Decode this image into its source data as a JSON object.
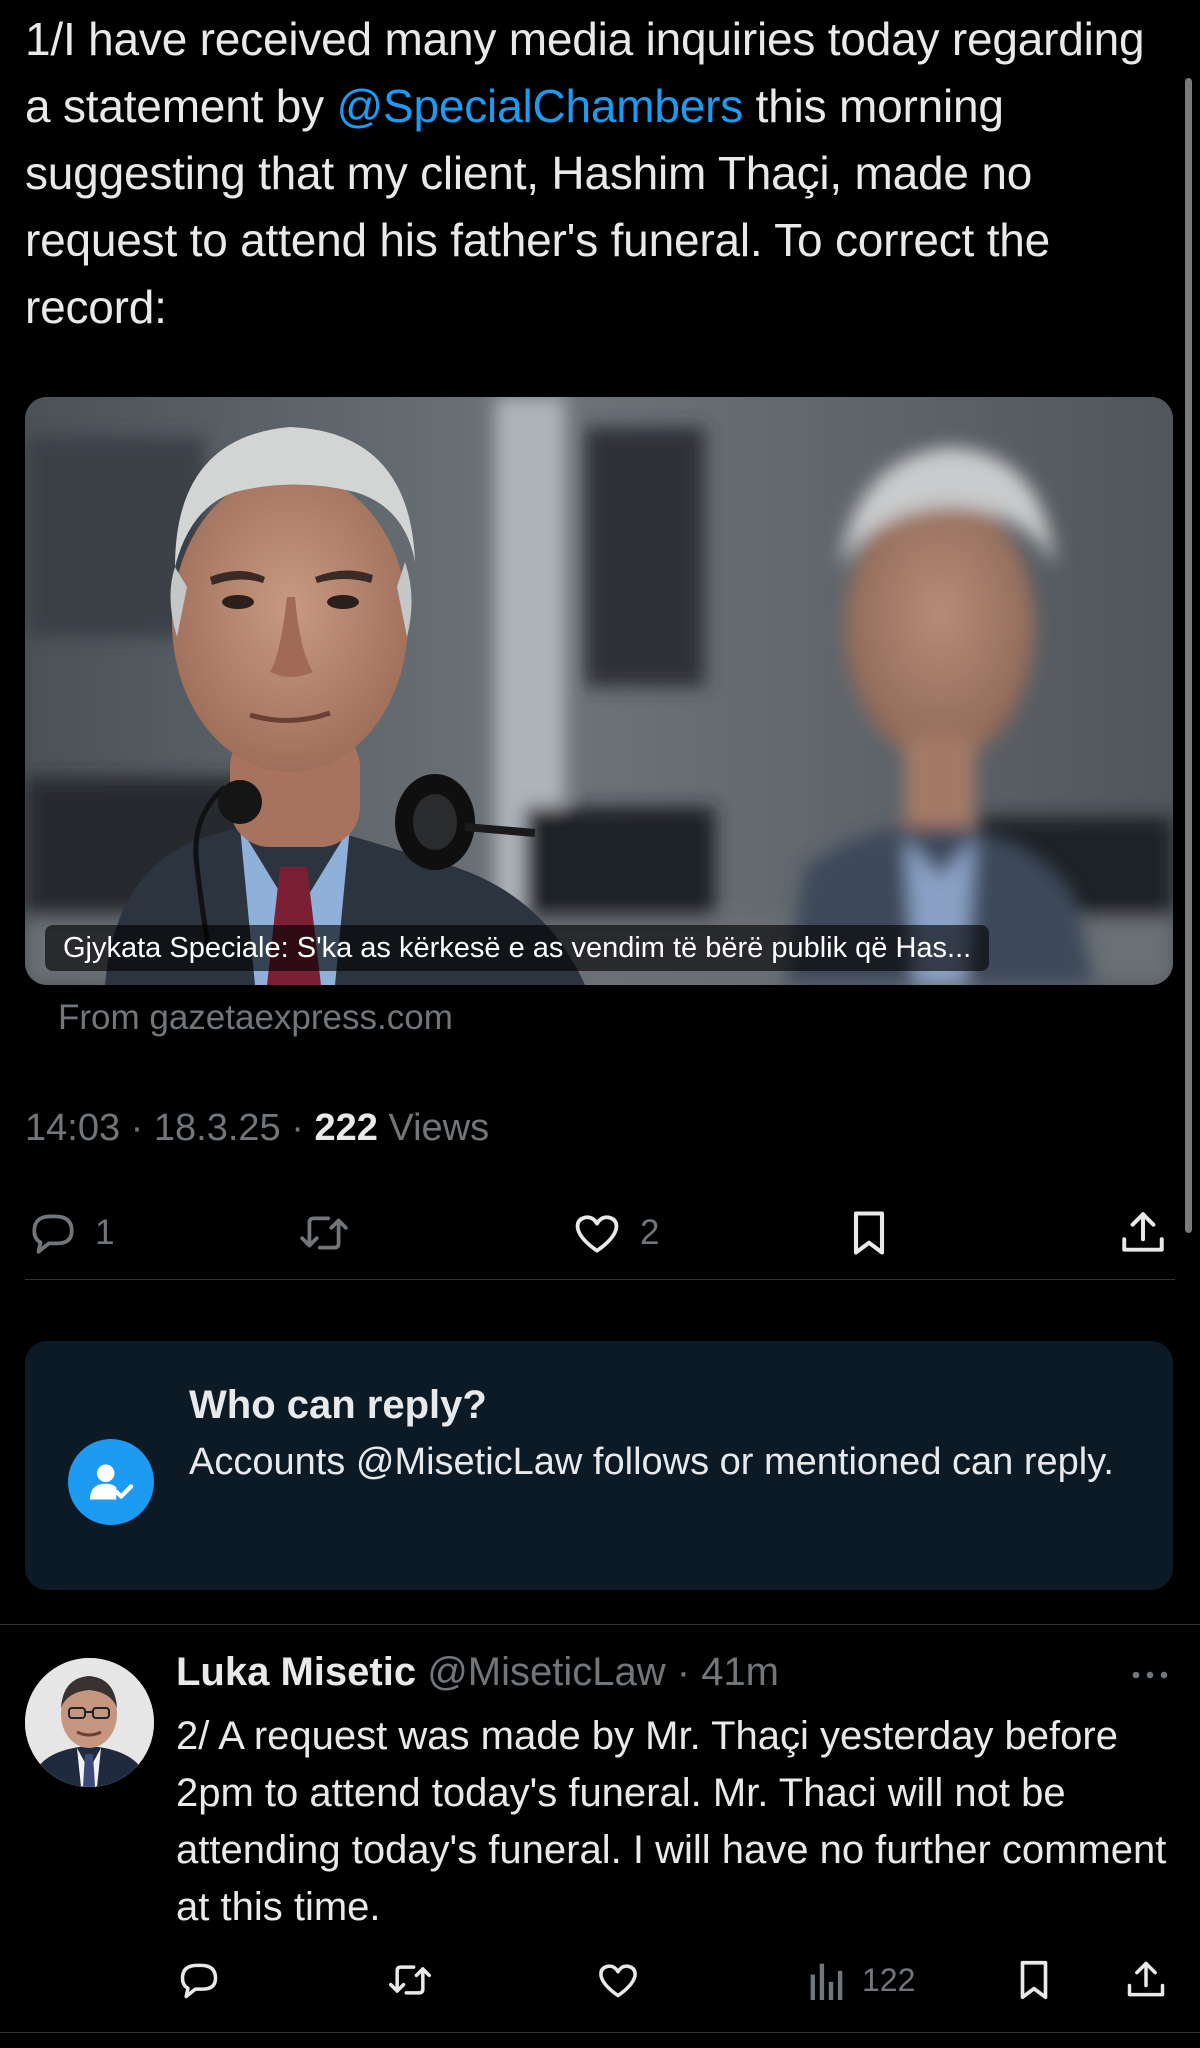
{
  "tweet": {
    "text_before_mention": "1/I have received many media inquiries today regarding a statement by ",
    "mention": "@SpecialChambers",
    "text_after_mention": " this morning suggesting that my client, Hashim Thaçi, made no request to attend his father's funeral. To correct the record:",
    "link_card": {
      "caption": "Gjykata Speciale: S'ka as kërkesë e as vendim të bërë publik që Has...",
      "source": "From gazetaexpress.com"
    },
    "time": "14:03",
    "date": "18.3.25",
    "meta_separator": " · ",
    "views_count": "222",
    "views_label": " Views",
    "actions": {
      "reply_count": "1",
      "repost_count": "",
      "like_count": "2"
    }
  },
  "who_can_reply": {
    "title": "Who can reply?",
    "description": "Accounts @MiseticLaw follows or mentioned can reply."
  },
  "reply": {
    "author_name": "Luka Misetic",
    "handle": "@MiseticLaw",
    "separator": " · ",
    "time_ago": "41m",
    "text": "2/ A request was made by Mr. Thaçi yesterday before 2pm to attend today's funeral. Mr. Thaci will not be attending today's funeral. I will have no further comment at this time.",
    "views_count": "122"
  },
  "colors": {
    "background": "#000000",
    "text_primary": "#e7e9ea",
    "text_secondary": "#71767b",
    "accent": "#1d9bf0",
    "divider": "#2f3336",
    "reply_box_bg": "#0c1a26"
  },
  "icons": [
    "reply-icon",
    "repost-icon",
    "like-icon",
    "bookmark-icon",
    "share-icon",
    "views-icon",
    "more-icon",
    "add-person-icon"
  ]
}
